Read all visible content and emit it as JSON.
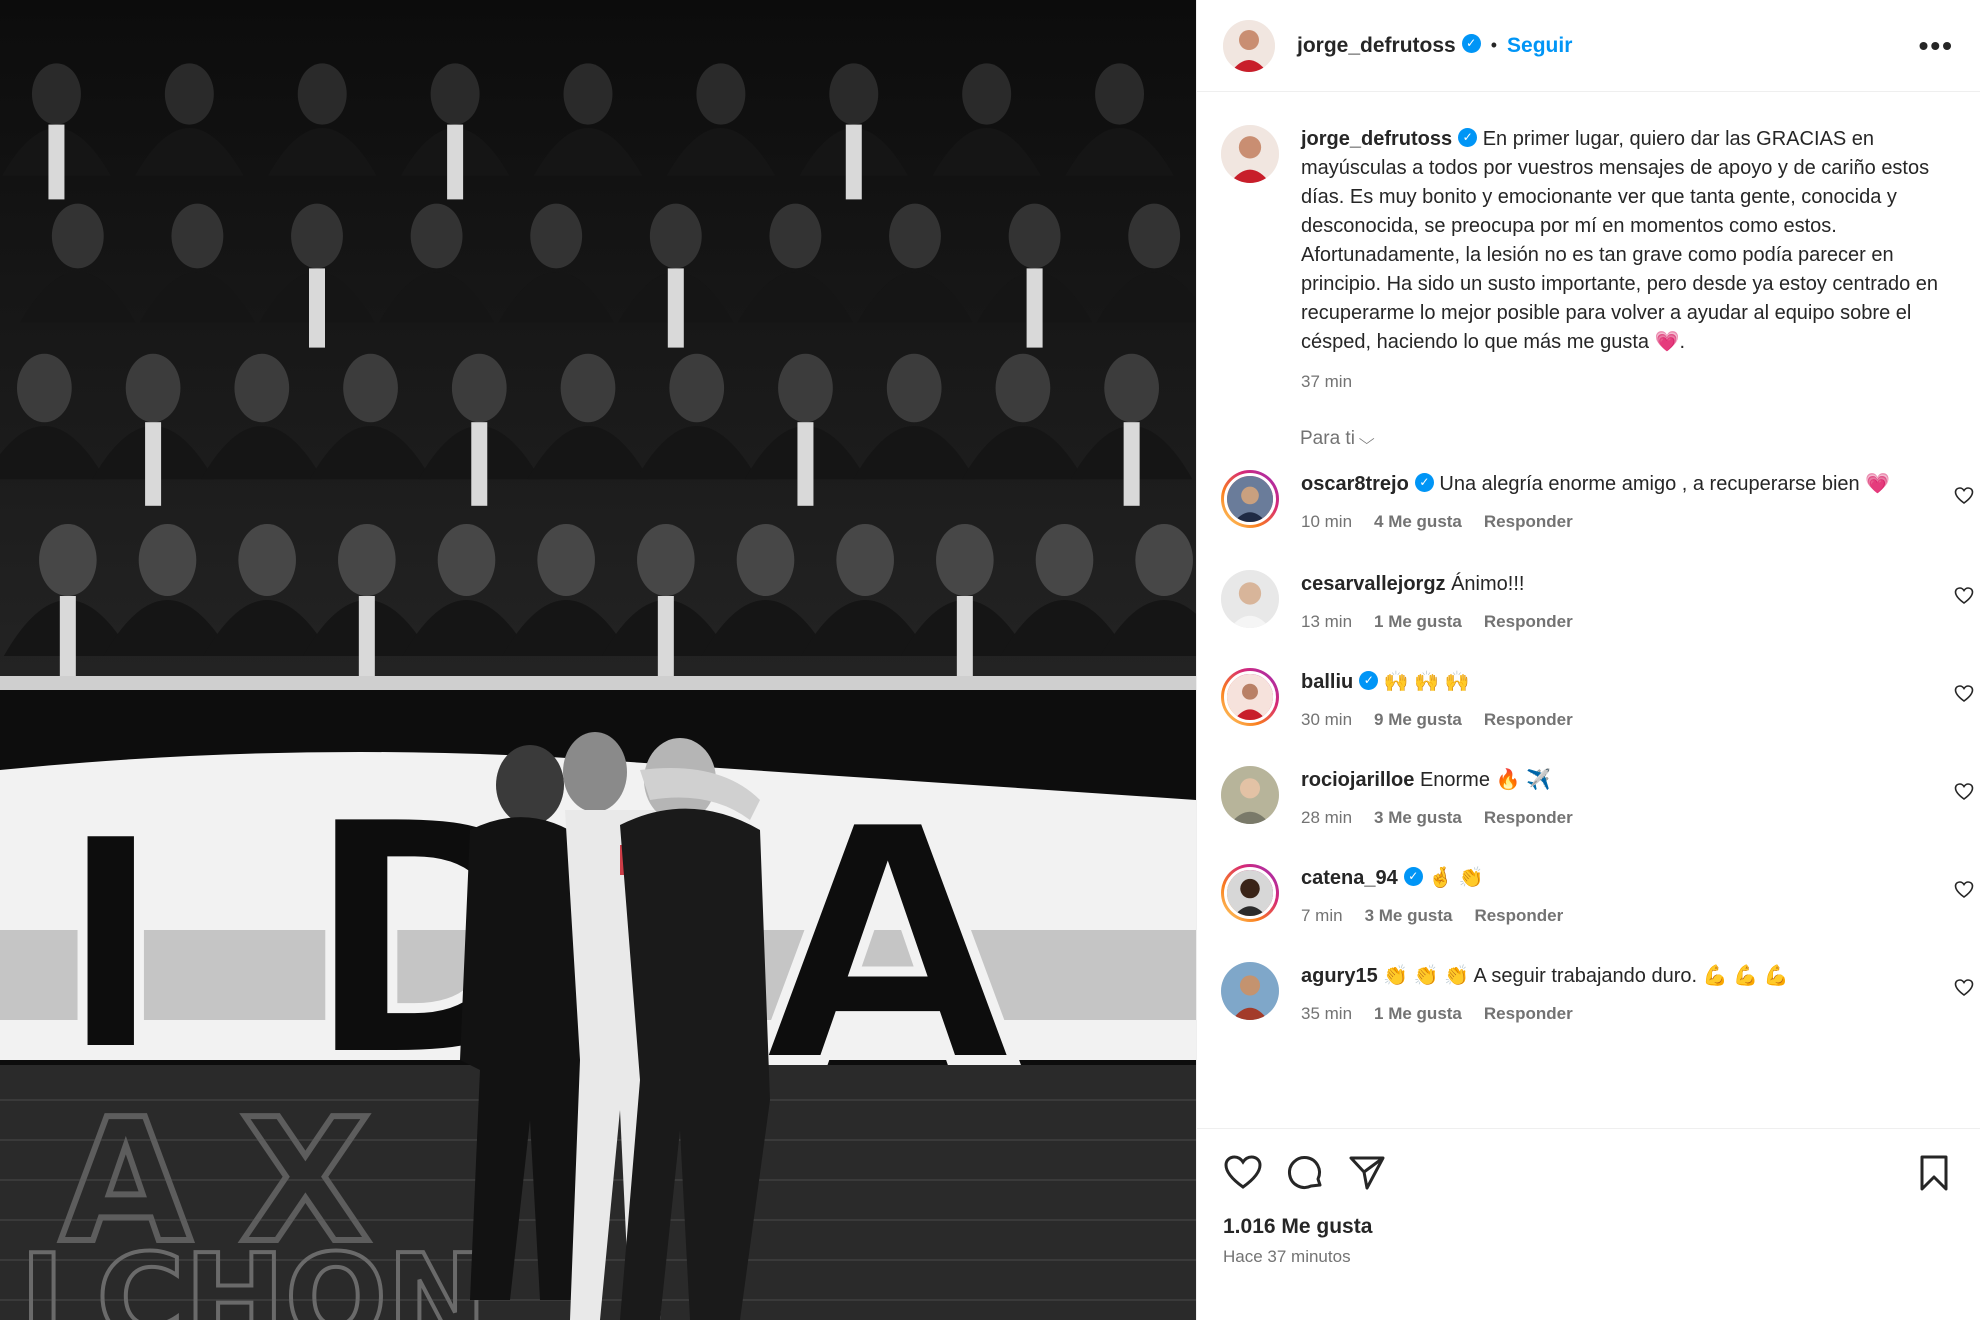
{
  "post": {
    "author": "jorge_defrutoss",
    "follow_label": "Seguir",
    "dot": "•",
    "more_label": "•••",
    "verified_mark": "✓",
    "caption_text": "En primer lugar, quiero dar las GRACIAS en mayúsculas a todos por vuestros mensajes de apoyo y de cariño estos días. Es muy bonito y emocionante ver que tanta gente, conocida y desconocida, se preocupa por mí en momentos como estos.",
    "caption_text_2": "Afortunadamente, la lesión no es tan grave como podía parecer en principio. Ha sido un susto importante, pero desde ya estoy centrado en recuperarme lo mejor posible para volver a ayudar al equipo sobre el césped, haciendo lo que más me gusta 💗.",
    "caption_time": "37 min",
    "sort_label": "Para ti",
    "sort_chevron": "⌵",
    "likes_count": "1.016 Me gusta",
    "posted_ago": "Hace 37 minutos"
  },
  "comments": [
    {
      "user": "oscar8trejo",
      "verified": true,
      "text": "Una alegría enorme amigo , a recuperarse bien 💗",
      "time": "10 min",
      "likes": "4 Me gusta",
      "reply": "Responder"
    },
    {
      "user": "cesarvallejorgz",
      "verified": false,
      "text": "Ánimo!!!",
      "time": "13 min",
      "likes": "1 Me gusta",
      "reply": "Responder"
    },
    {
      "user": "balliu",
      "verified": true,
      "text": "🙌 🙌 🙌",
      "time": "30 min",
      "likes": "9 Me gusta",
      "reply": "Responder"
    },
    {
      "user": "rociojarilloe",
      "verified": false,
      "text": "Enorme 🔥 ✈️",
      "time": "28 min",
      "likes": "3 Me gusta",
      "reply": "Responder"
    },
    {
      "user": "catena_94",
      "verified": true,
      "text": "🤞 👏",
      "time": "7 min",
      "likes": "3 Me gusta",
      "reply": "Responder"
    },
    {
      "user": "agury15",
      "verified": false,
      "text": "👏 👏 👏 A seguir trabajando duro. 💪 💪 💪",
      "time": "35 min",
      "likes": "1 Me gusta",
      "reply": "Responder"
    }
  ],
  "photo": {
    "banner_letters": [
      "I",
      "D",
      "A"
    ],
    "board_letters": [
      "A",
      "X"
    ],
    "board_word": "LCHON",
    "colors": {
      "bg": "#161616",
      "banner": "#f2f2f2",
      "shirt_red": "#c81e2a"
    }
  },
  "colors": {
    "accent": "#0095f6",
    "muted": "#737373",
    "text": "#262626",
    "heart": "#ff3d7f"
  }
}
